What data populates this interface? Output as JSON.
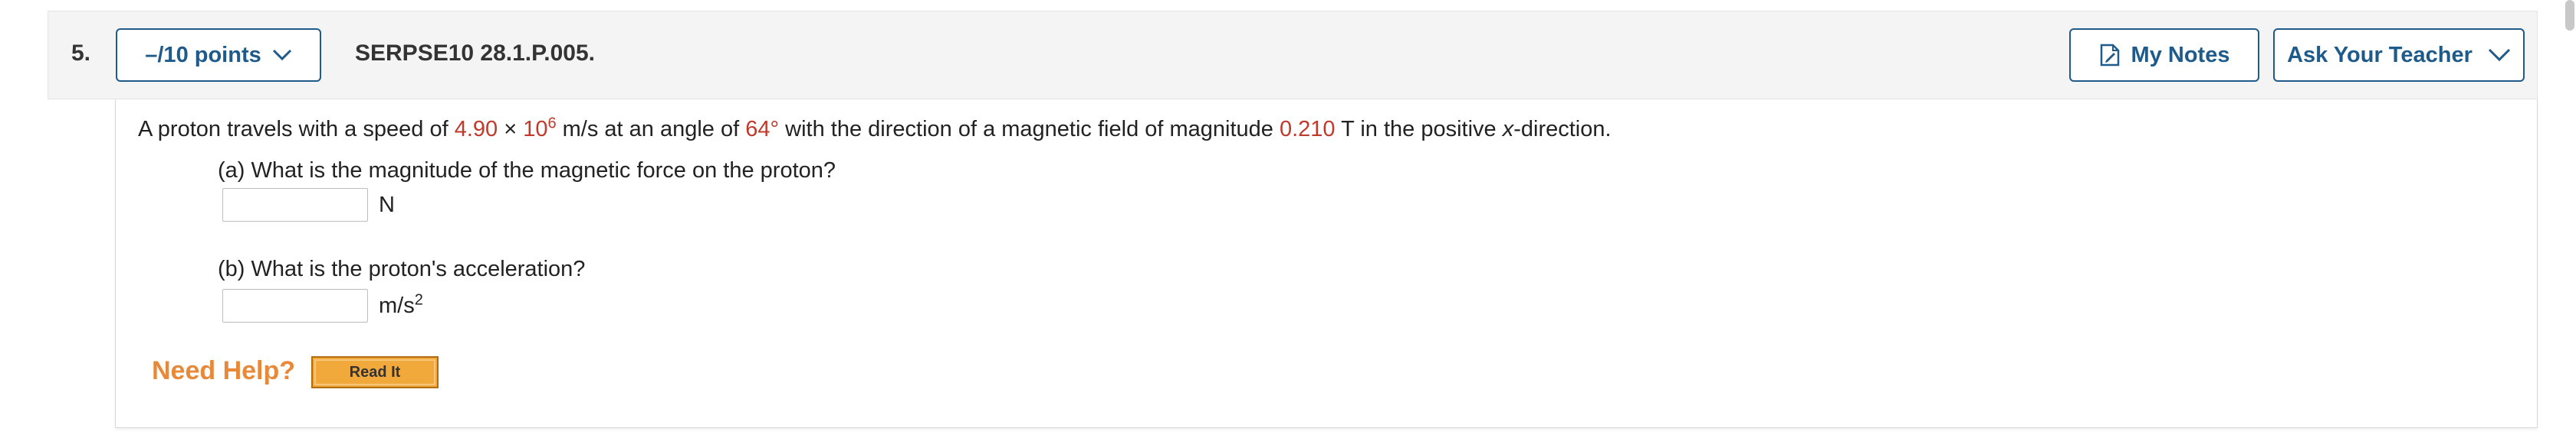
{
  "question": {
    "number": "5.",
    "points_label": "–/10 points",
    "id": "SERPSE10 28.1.P.005."
  },
  "toolbar": {
    "notes_label": "My Notes",
    "ask_label": "Ask Your Teacher"
  },
  "statement": {
    "t1": "A proton travels with a speed of ",
    "speed_mantissa": "4.90",
    "times": " × ",
    "speed_base": "10",
    "speed_exp": "6",
    "t2": " m/s at an angle of ",
    "angle": "64°",
    "t3": " with the direction of a magnetic field of magnitude ",
    "field": "0.210",
    "t4": " T in the positive ",
    "axis": "x",
    "t5": "-direction."
  },
  "parts": [
    {
      "prompt": "(a) What is the magnitude of the magnetic force on the proton?",
      "value": "",
      "unit": "N"
    },
    {
      "prompt": "(b) What is the proton's acceleration?",
      "value": "",
      "unit_base": "m/s",
      "unit_exp": "2"
    }
  ],
  "help": {
    "label": "Need Help?",
    "read_it": "Read It"
  },
  "colors": {
    "accent": "#1e5a8a",
    "value_red": "#c0392b",
    "help_orange": "#e8893a",
    "read_it_bg": "#f2a93b"
  },
  "icons": {
    "points_chevron": "chevron-down-icon",
    "notes": "notes-icon",
    "ask_chevron": "chevron-down-icon"
  }
}
